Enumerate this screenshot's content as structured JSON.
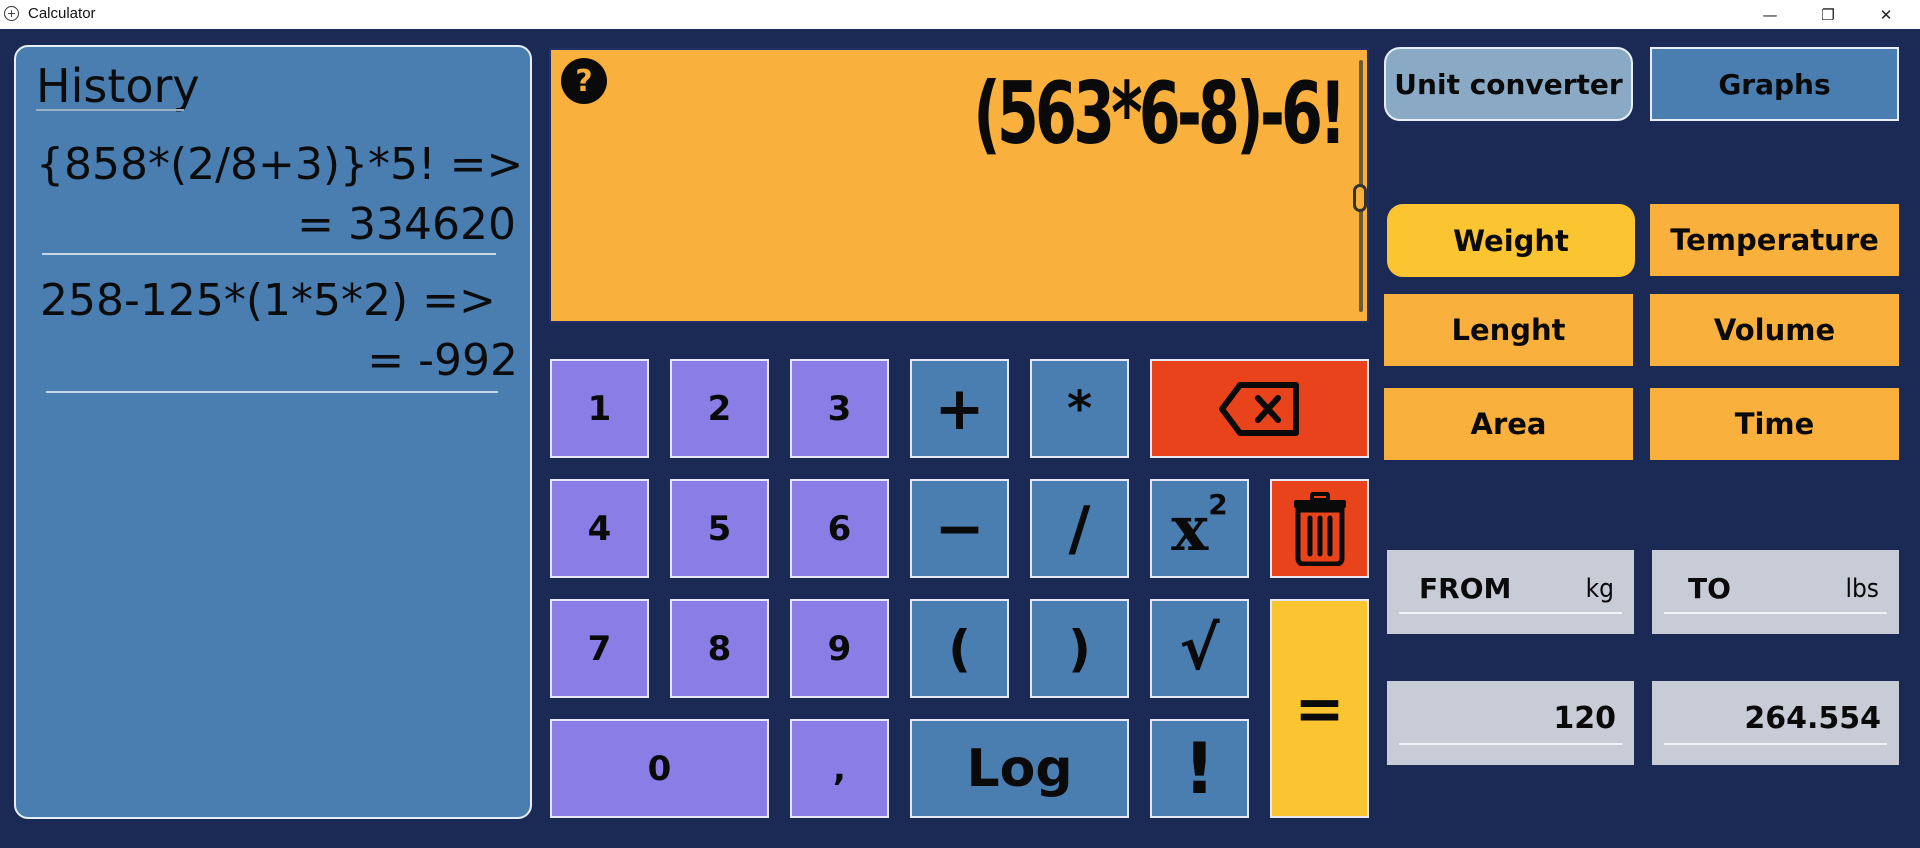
{
  "window": {
    "icon": "app-icon",
    "title": "Calculator",
    "minimize": "—",
    "maximize": "❐",
    "close": "✕"
  },
  "history": {
    "title": "History",
    "entries": [
      {
        "expression": "{858*(2/8+3)}*5! =>",
        "result": "= 334620"
      },
      {
        "expression": "258-125*(1*5*2) =>",
        "result": "=      -992"
      }
    ]
  },
  "display": {
    "help": "?",
    "text": "(563*6-8)-6!"
  },
  "keypad": {
    "k1": "1",
    "k2": "2",
    "k3": "3",
    "k4": "4",
    "k5": "5",
    "k6": "6",
    "k7": "7",
    "k8": "8",
    "k9": "9",
    "k0": "0",
    "comma": ",",
    "plus": "+",
    "mul": "*",
    "minus": "−",
    "div": "/",
    "lparen": "(",
    "rparen": ")",
    "log": "Log",
    "square_base": "x",
    "square_exp": "2",
    "sqrt": "√",
    "factorial": "!",
    "equals": "="
  },
  "right": {
    "unit_converter": "Unit converter",
    "graphs": "Graphs",
    "categories": {
      "weight": "Weight",
      "temperature": "Temperature",
      "length": "Lenght",
      "volume": "Volume",
      "area": "Area",
      "time": "Time"
    },
    "selected_category": "Weight",
    "from_label": "FROM",
    "from_unit": "kg",
    "to_label": "TO",
    "to_unit": "lbs",
    "from_value": "120",
    "to_value": "264.554"
  },
  "colors": {
    "background": "#1b2a55",
    "number_key": "#8a7ee6",
    "operator_key": "#4a7db0",
    "delete_key": "#e8431b",
    "equals_key": "#fbc531",
    "display": "#f9b03c",
    "category": "#f9b03c",
    "category_selected": "#fbc531"
  }
}
